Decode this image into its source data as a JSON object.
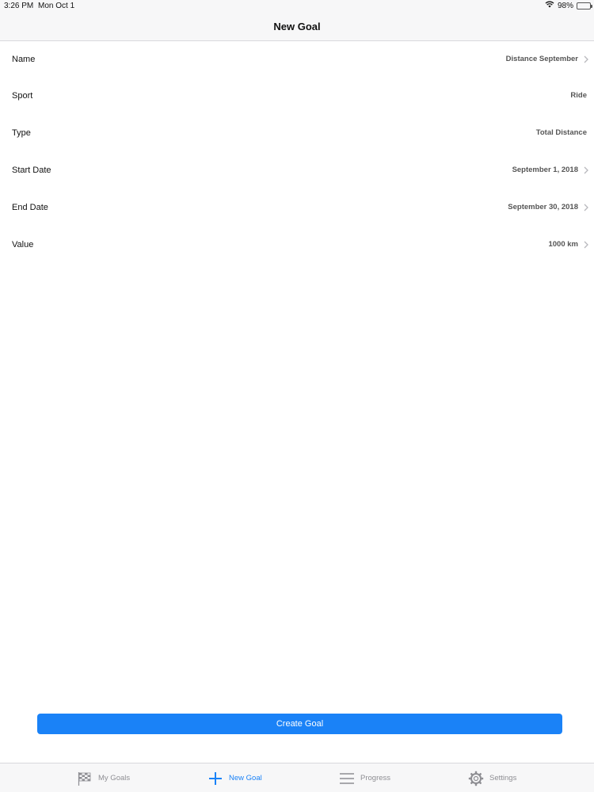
{
  "status_bar": {
    "time": "3:26 PM",
    "date": "Mon Oct 1",
    "battery": "98%",
    "battery_level": 0.98
  },
  "nav": {
    "title": "New Goal"
  },
  "form": {
    "rows": [
      {
        "label": "Name",
        "value": "Distance September",
        "chevron": true
      },
      {
        "label": "Sport",
        "value": "Ride",
        "chevron": false
      },
      {
        "label": "Type",
        "value": "Total Distance",
        "chevron": false
      },
      {
        "label": "Start Date",
        "value": "September 1, 2018",
        "chevron": true
      },
      {
        "label": "End Date",
        "value": "September 30, 2018",
        "chevron": true
      },
      {
        "label": "Value",
        "value": "1000 km",
        "chevron": true
      }
    ]
  },
  "create_button": {
    "label": "Create Goal"
  },
  "tabs": [
    {
      "label": "My Goals",
      "icon": "checkered-flag-icon",
      "active": false
    },
    {
      "label": "New Goal",
      "icon": "plus-icon",
      "active": true
    },
    {
      "label": "Progress",
      "icon": "list-lines-icon",
      "active": false
    },
    {
      "label": "Settings",
      "icon": "gear-icon",
      "active": false
    }
  ],
  "colors": {
    "accent": "#1a82f7",
    "tab_inactive": "#8e8e93",
    "bar_background": "#f7f7f8",
    "battery_green": "#35c759"
  }
}
